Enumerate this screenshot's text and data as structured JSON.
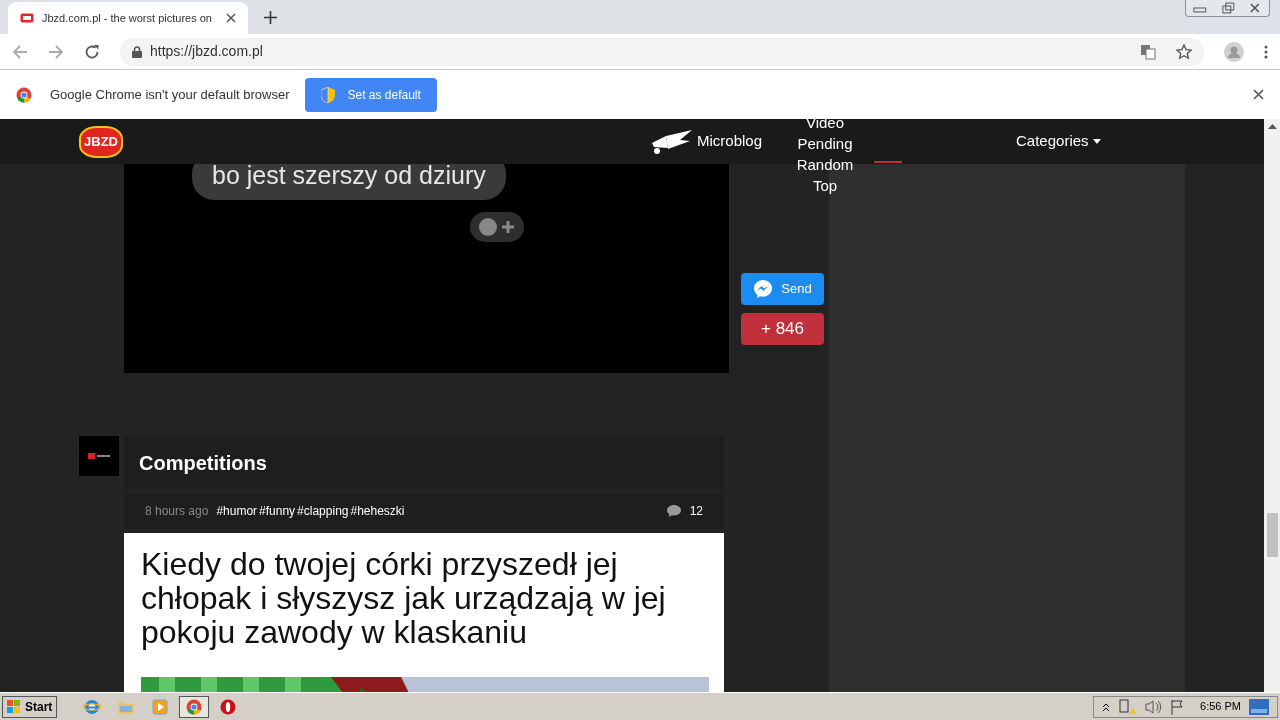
{
  "browser": {
    "tab": {
      "title": "Jbzd.com.pl - the worst pictures on",
      "selected": true
    },
    "url": "https://jbzd.com.pl",
    "infobar": {
      "message": "Google Chrome isn't your default browser",
      "button": "Set as default"
    }
  },
  "site": {
    "logo": "JBZD",
    "microblog": "Microblog",
    "menu": [
      "Video",
      "Pending",
      "Random",
      "Top"
    ],
    "categories": "Categories"
  },
  "post_top": {
    "bubble_text": "bo jest szerszy od dziury",
    "share": "Send",
    "votes": "+ 846"
  },
  "post": {
    "title": "Competitions",
    "time": "8 hours ago",
    "tags": [
      "#humor",
      "#funny",
      "#clapping",
      "#heheszki"
    ],
    "comments": "12",
    "caption": "Kiedy do twojej córki przyszedł jej chłopak i słyszysz jak urządzają w jej pokoju zawody w klaskaniu"
  },
  "taskbar": {
    "start": "Start",
    "apps": [
      {
        "kind": "ie",
        "selected": false
      },
      {
        "kind": "folder",
        "selected": false
      },
      {
        "kind": "media",
        "selected": false
      },
      {
        "kind": "chrome",
        "selected": true
      },
      {
        "kind": "opera",
        "selected": false
      }
    ],
    "clock": "6:56 PM"
  }
}
